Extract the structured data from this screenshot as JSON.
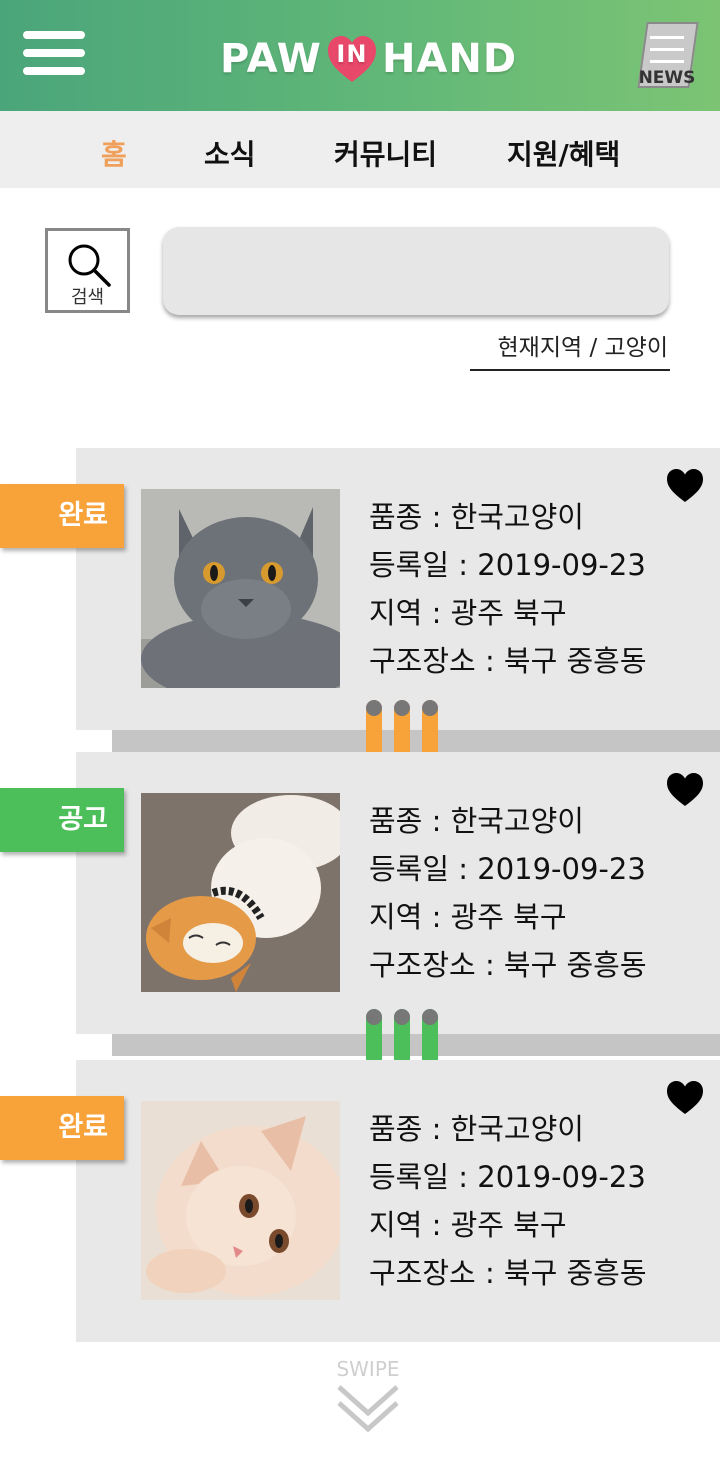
{
  "header": {
    "logo_left": "PAW",
    "logo_mid": "IN",
    "logo_right": "HAND",
    "news_label": "NEWS",
    "menu_icon": "hamburger-menu-icon",
    "news_icon": "newspaper-icon"
  },
  "tabs": [
    {
      "label": "홈",
      "active": true
    },
    {
      "label": "소식",
      "active": false
    },
    {
      "label": "커뮤니티",
      "active": false
    },
    {
      "label": "지원/혜택",
      "active": false
    }
  ],
  "search": {
    "button_label": "검색",
    "placeholder": "",
    "filter_label": "현재지역 / 고양이"
  },
  "colors": {
    "header_gradient_start": "#4aa57a",
    "header_gradient_end": "#7cc474",
    "active_tab": "#f0a05a",
    "status_complete": "#f8a23a",
    "status_notice": "#4cbf5a",
    "card_bg": "#e8e8e8"
  },
  "listings": [
    {
      "status": "완료",
      "status_type": "complete",
      "breed": "품종 : 한국고양이",
      "registered": "등록일 : 2019-09-23",
      "region": "지역 : 광주 북구",
      "rescue_place": "구조장소 : 북구 중흥동",
      "favorite_icon": "heart-icon"
    },
    {
      "status": "공고",
      "status_type": "notice",
      "breed": "품종 : 한국고양이",
      "registered": "등록일 : 2019-09-23",
      "region": "지역 : 광주 북구",
      "rescue_place": "구조장소 : 북구 중흥동",
      "favorite_icon": "heart-icon"
    },
    {
      "status": "완료",
      "status_type": "complete",
      "breed": "품종 : 한국고양이",
      "registered": "등록일 : 2019-09-23",
      "region": "지역 : 광주 북구",
      "rescue_place": "구조장소 : 북구 중흥동",
      "favorite_icon": "heart-icon"
    }
  ],
  "swipe": {
    "label": "SWIPE",
    "icon": "double-chevron-down-icon"
  }
}
